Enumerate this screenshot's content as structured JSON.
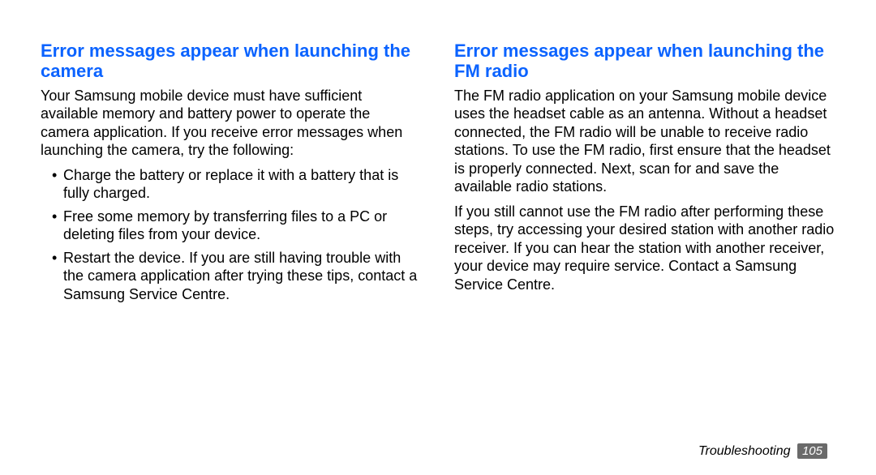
{
  "left": {
    "heading": "Error messages appear when launching the camera",
    "intro": "Your Samsung mobile device must have sufficient available memory and battery power to operate the camera application. If you receive error messages when launching the camera, try the following:",
    "bullets": [
      "Charge the battery or replace it with a battery that is fully charged.",
      "Free some memory by transferring files to a PC or deleting files from your device.",
      "Restart the device. If you are still having trouble with the camera application after trying these tips, contact a Samsung Service Centre."
    ]
  },
  "right": {
    "heading": "Error messages appear when launching the FM radio",
    "para1": "The FM radio application on your Samsung mobile device uses the headset cable as an antenna. Without a headset connected, the FM radio will be unable to receive radio stations. To use the FM radio, first ensure that the headset is properly connected. Next, scan for and save the available radio stations.",
    "para2": "If you still cannot use the FM radio after performing these steps, try accessing your desired station with another radio receiver. If you can hear the station with another receiver, your device may require service. Contact a Samsung Service Centre."
  },
  "footer": {
    "section": "Troubleshooting",
    "page": "105"
  }
}
